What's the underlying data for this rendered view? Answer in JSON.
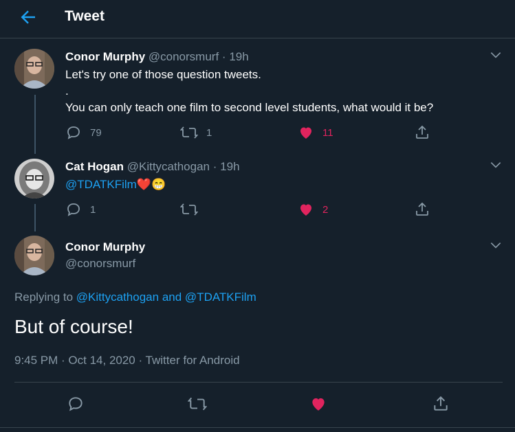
{
  "header": {
    "title": "Tweet"
  },
  "tweets": [
    {
      "name": "Conor Murphy",
      "handle": "@conorsmurf",
      "sep": "·",
      "time": "19h",
      "lines": [
        "Let's try one of those question tweets.",
        ".",
        "You can only teach one film to second level students, what would it be?"
      ],
      "replies": "79",
      "retweets": "1",
      "likes": "11"
    },
    {
      "name": "Cat Hogan",
      "handle": "@Kittycathogan",
      "sep": "·",
      "time": "19h",
      "mention": "@TDATKFilm",
      "emoji": "❤️😁",
      "replies": "1",
      "retweets": "",
      "likes": "2"
    }
  ],
  "main": {
    "name": "Conor Murphy",
    "handle": "@conorsmurf",
    "replying_prefix": "Replying to",
    "replying_user1": "@Kittycathogan",
    "replying_and": "and",
    "replying_user2": "@TDATKFilm",
    "text": "But of course!",
    "timestamp": "9:45 PM · Oct 14, 2020 · Twitter for Android"
  },
  "icons": {
    "back": "arrow-left-icon",
    "reply": "reply-icon",
    "retweet": "retweet-icon",
    "like": "heart-icon",
    "share": "share-icon",
    "more": "chevron-down-icon"
  },
  "colors": {
    "background": "#15202b",
    "accent": "#1da1f2",
    "like": "#e0245e",
    "muted": "#8899a6"
  }
}
